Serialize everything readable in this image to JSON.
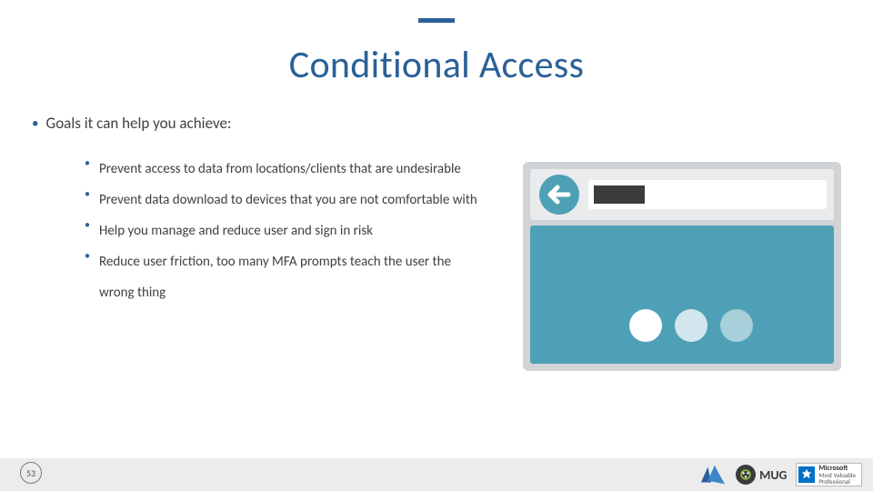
{
  "title": "Conditional Access",
  "body": {
    "lead": "Goals it can help you achieve:",
    "sub_bullets": [
      "Prevent access to data from locations/clients that are undesirable",
      "Prevent data download to devices that you are not comfortable with",
      "Help you manage and reduce user and sign in risk",
      "Reduce user friction, too many MFA prompts teach the user the wrong thing"
    ]
  },
  "colors": {
    "accent": "#2a6099",
    "teal": "#4ea0b7",
    "gray": "#95a5a6",
    "footer_bg": "#ececec"
  },
  "page_number": "53",
  "logos": {
    "mug_label": "MUG",
    "mvp_line1": "Microsoft",
    "mvp_line2": "Most Valuable",
    "mvp_line3": "Professional"
  }
}
